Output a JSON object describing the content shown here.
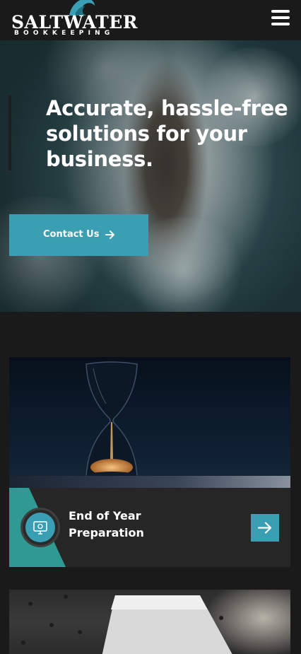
{
  "header": {
    "logo_word": "SALTWATER",
    "logo_sub": "BOOKKEEPING",
    "menu_icon": "hamburger-icon"
  },
  "hero": {
    "title": "Accurate, hassle-free solutions for your business.",
    "cta_label": "Contact Us",
    "cta_icon": "arrow-right-icon"
  },
  "services": [
    {
      "title": "End of Year Preparation",
      "image": "hourglass",
      "icon": "computer-icon",
      "button_icon": "arrow-right-icon"
    },
    {
      "image": "laptop-meeting"
    }
  ],
  "colors": {
    "accent": "#3a9fb3",
    "background": "#1a1a1a",
    "card": "#262626",
    "text": "#ffffff"
  }
}
